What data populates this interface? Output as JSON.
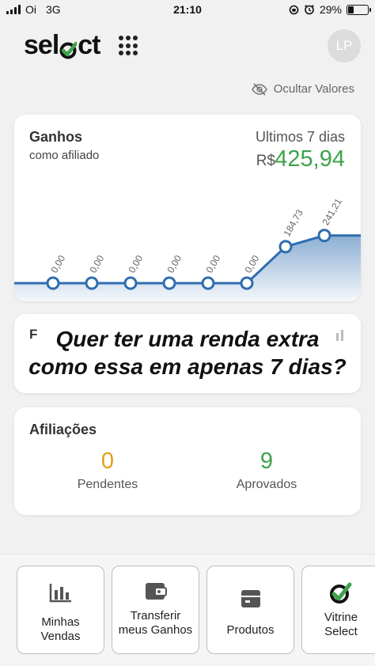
{
  "status_bar": {
    "carrier": "Oi",
    "network": "3G",
    "time": "21:10",
    "battery": "29%",
    "battery_level": 0.29
  },
  "header": {
    "logo_text_left": "sel",
    "logo_text_right": "ct",
    "avatar_initials": "LP"
  },
  "hide_values": {
    "label": "Ocultar Valores",
    "icon": "eye-off-icon"
  },
  "earnings": {
    "title": "Ganhos",
    "subtitle": "como afiliado",
    "period": "Ultimos 7 dias",
    "currency": "R$",
    "total": "425,94",
    "accent_color": "#3ea34a"
  },
  "chart_data": {
    "type": "area",
    "values": [
      0,
      0,
      0,
      0,
      0,
      0,
      184.73,
      241.21
    ],
    "labels": [
      "0,00",
      "0,00",
      "0,00",
      "0,00",
      "0,00",
      "0,00",
      "184,73",
      "241,21"
    ],
    "line_color": "#2e6db0",
    "ylim": [
      0,
      260
    ]
  },
  "promo": {
    "label": "F",
    "line1": "Quer ter uma renda extra",
    "line2": "como essa em apenas 7 dias?"
  },
  "affiliations": {
    "title": "Afiliações",
    "pending_count": "0",
    "pending_label": "Pendentes",
    "approved_count": "9",
    "approved_label": "Aprovados"
  },
  "bottom_nav": [
    {
      "label": "Minhas Vendas",
      "icon": "bar-chart-icon"
    },
    {
      "label": "Transferir meus Ganhos",
      "icon": "wallet-icon"
    },
    {
      "label": "Produtos",
      "icon": "box-icon"
    },
    {
      "label": "Vitrine Select",
      "icon": "select-check-icon"
    }
  ]
}
